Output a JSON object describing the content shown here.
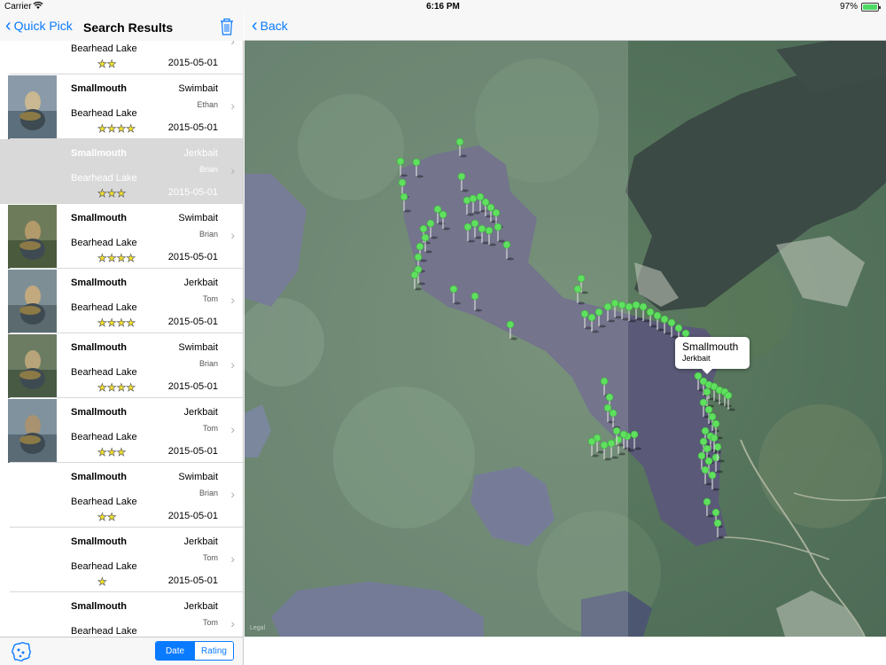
{
  "status": {
    "carrier": "Carrier",
    "time": "6:16 PM",
    "battery": "97%"
  },
  "left_nav": {
    "back_label": "Quick Pick",
    "title": "Search Results"
  },
  "right_nav": {
    "back_label": "Back"
  },
  "catches": [
    {
      "species": "",
      "bait": "",
      "angler": "",
      "lake": "Bearhead Lake",
      "stars": "★★",
      "date": "2015-05-01",
      "photo": false
    },
    {
      "species": "Smallmouth",
      "bait": "Swimbait",
      "angler": "Ethan",
      "lake": "Bearhead Lake",
      "stars": "★★★★",
      "date": "2015-05-01",
      "photo": true
    },
    {
      "species": "Smallmouth",
      "bait": "Jerkbait",
      "angler": "Brian",
      "lake": "Bearhead Lake",
      "stars": "★★★",
      "date": "2015-05-01",
      "photo": false
    },
    {
      "species": "Smallmouth",
      "bait": "Swimbait",
      "angler": "Brian",
      "lake": "Bearhead Lake",
      "stars": "★★★★",
      "date": "2015-05-01",
      "photo": true
    },
    {
      "species": "Smallmouth",
      "bait": "Jerkbait",
      "angler": "Tom",
      "lake": "Bearhead Lake",
      "stars": "★★★★",
      "date": "2015-05-01",
      "photo": true
    },
    {
      "species": "Smallmouth",
      "bait": "Swimbait",
      "angler": "Brian",
      "lake": "Bearhead Lake",
      "stars": "★★★★",
      "date": "2015-05-01",
      "photo": true
    },
    {
      "species": "Smallmouth",
      "bait": "Jerkbait",
      "angler": "Tom",
      "lake": "Bearhead Lake",
      "stars": "★★★",
      "date": "2015-05-01",
      "photo": true
    },
    {
      "species": "Smallmouth",
      "bait": "Swimbait",
      "angler": "Brian",
      "lake": "Bearhead Lake",
      "stars": "★★",
      "date": "2015-05-01",
      "photo": false
    },
    {
      "species": "Smallmouth",
      "bait": "Jerkbait",
      "angler": "Tom",
      "lake": "Bearhead Lake",
      "stars": "★",
      "date": "2015-05-01",
      "photo": false
    },
    {
      "species": "Smallmouth",
      "bait": "Jerkbait",
      "angler": "Tom",
      "lake": "Bearhead Lake",
      "stars": "",
      "date": "",
      "photo": false
    }
  ],
  "selected_index": 2,
  "sort": {
    "date_label": "Date",
    "rating_label": "Rating",
    "active": "date"
  },
  "callout": {
    "title": "Smallmouth",
    "subtitle": "Jerkbait"
  },
  "map": {
    "legal": "Legal"
  },
  "colors": {
    "accent": "#0a7aff",
    "pin": "#5fe05f",
    "selected_row": "#d9d9d9",
    "star": "#f3e12a"
  }
}
